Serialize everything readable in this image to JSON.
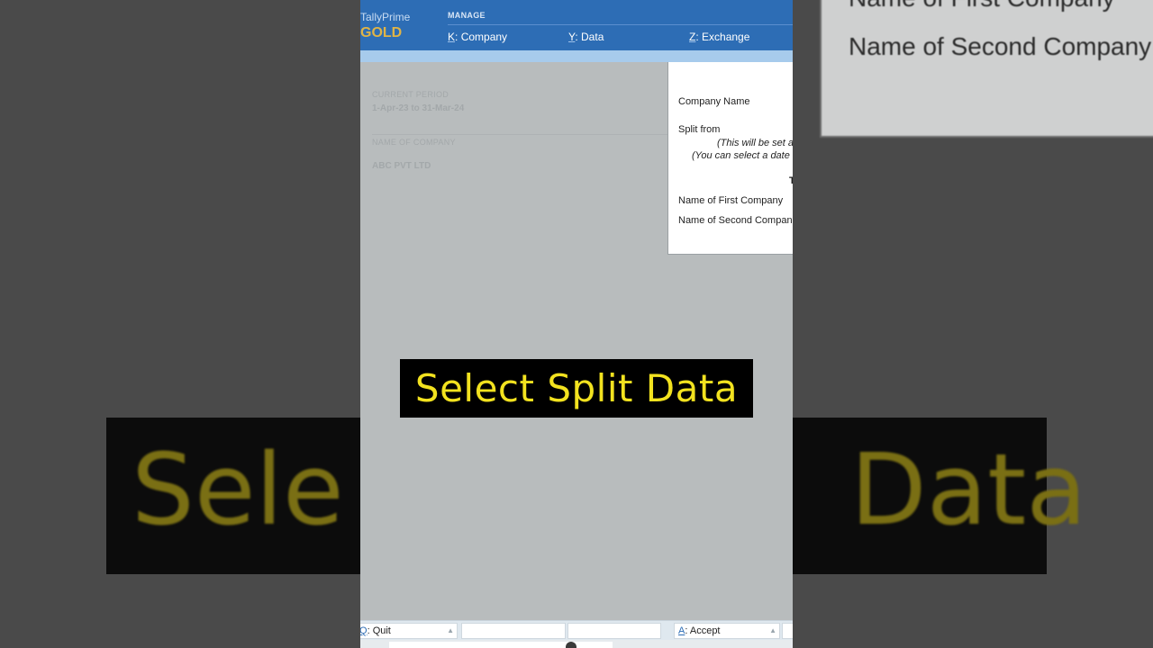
{
  "background": {
    "panel_lines": [
      "Name of First Company",
      "Name of Second Company"
    ],
    "caption_left": "Sele",
    "caption_right": "Data"
  },
  "app": {
    "brand_name": "TallyPrime",
    "brand_edition": "GOLD"
  },
  "menu": {
    "title": "MANAGE",
    "items": [
      {
        "key": "K",
        "label": "Company"
      },
      {
        "key": "Y",
        "label": "Data"
      },
      {
        "key": "Z",
        "label": "Exchange"
      }
    ]
  },
  "company_panel": {
    "period_label": "CURRENT PERIOD",
    "period_value": "1-Apr-23 to 31-Mar-24",
    "company_label": "NAME OF COMPANY",
    "company_value": "ABC PVT LTD"
  },
  "split_dialog": {
    "company_name_label": "Company Name",
    "split_from_label": "Split from",
    "note_line1": "(This will be set a",
    "note_line2": "(You can select a date",
    "heading_fragment": "T",
    "first_company_label": "Name of First Company",
    "second_company_label": "Name of Second Compan"
  },
  "caption": "Select Split Data",
  "bottom_bar": {
    "quit": {
      "key": "Q",
      "label": "Quit"
    },
    "accept": {
      "key": "A",
      "label": "Accept"
    }
  },
  "colors": {
    "topbar": "#2d6db5",
    "edition": "#e0b446",
    "caption_text": "#f2e21f"
  }
}
